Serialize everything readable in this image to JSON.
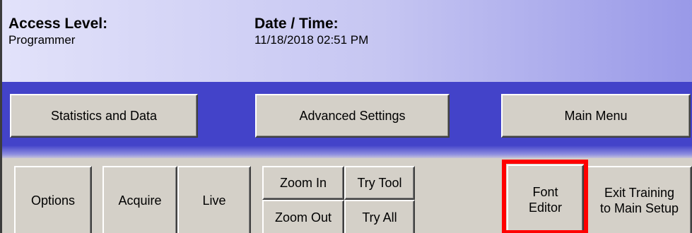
{
  "header": {
    "access_level": {
      "label": "Access Level:",
      "value": "Programmer"
    },
    "datetime": {
      "label": "Date / Time:",
      "value": "11/18/2018 02:51 PM"
    }
  },
  "nav": {
    "statistics_label": "Statistics and Data",
    "advanced_label": "Advanced Settings",
    "main_menu_label": "Main Menu"
  },
  "toolbar": {
    "options_label": "Options",
    "acquire_label": "Acquire",
    "live_label": "Live",
    "zoom_in_label": "Zoom In",
    "zoom_out_label": "Zoom Out",
    "try_tool_label": "Try Tool",
    "try_all_label": "Try All",
    "font_editor_line1": "Font",
    "font_editor_line2": "Editor",
    "exit_training_line1": "Exit Training",
    "exit_training_line2": "to Main Setup"
  },
  "colors": {
    "panel": "#d4d0c8",
    "band": "#4343c9",
    "header_gradient_start": "#e2e2fa",
    "header_gradient_end": "#9999e8",
    "highlight": "#ff0000"
  }
}
